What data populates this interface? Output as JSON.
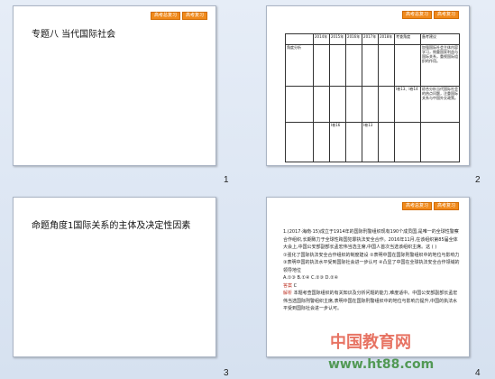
{
  "slides": [
    {
      "number": "1",
      "title": "专题八  当代国际社会",
      "tags": [
        "高考总复习",
        "高考复习"
      ]
    },
    {
      "number": "2",
      "tags": [
        "高考总复习",
        "高考复习"
      ],
      "table": {
        "header": [
          "2014年",
          "2015年",
          "2016年",
          "2017年",
          "2018年",
          "考查角度",
          "备考建议"
        ],
        "rows": [
          [
            "角度分析",
            "",
            "",
            "",
            "",
            "",
            "加强国际社会主体内容学习，侧重国家利益与国际关系，重视国际组织的作用。"
          ],
          [
            "",
            "",
            "",
            "",
            "",
            "Ⅰ卷13、Ⅰ卷14",
            "综合分析当代国际社会的热点问题，注重国际关系与中国外交政策。"
          ],
          [
            "",
            "Ⅰ卷16",
            "",
            "Ⅰ卷13",
            "",
            "",
            ""
          ]
        ]
      }
    },
    {
      "number": "3",
      "title": "命题角度1国际关系的主体及决定性因素"
    },
    {
      "number": "4",
      "tags": [
        "高考总复习",
        "高考复习"
      ],
      "question": {
        "stem": "1.(2017·海南·15)成立于1914年的国际刑警组织现有190个成员国,是唯一的全球性警察合作组织,长期致力于全球性跨国犯罪执法安全合作。2016年11月,在该组织第85届全体大会上,中国公安部副部长孟宏伟当选主席,中国人首次当选该组织主席。这 (     )",
        "options": "①强化了国际执法安全合作组织的制度建设    ②表明中国在国际刑警组织中的地位与影响力    ③表明中国的执法水平受到国际社会进一步认可    ④凸显了中国在全球执法安全合作领域的领导地位",
        "choices": "A.①③   B.①④   C.②③   D.②④",
        "answer_label": "答案",
        "answer": "C",
        "analysis_label": "解析",
        "analysis": "本题考查国际组织的有关知识及分析问题的能力,难度适中。中国公安部副部长孟宏伟当选国际刑警组织主席,表明中国在国际刑警组织中的地位与影响力提升,中国的执法水平受到国际社会进一步认可。"
      }
    }
  ],
  "watermark": {
    "text_top": "中国教育网",
    "text_bottom": "www.ht88.com",
    "color": "#e0452f",
    "color2": "#3b8d3b"
  }
}
